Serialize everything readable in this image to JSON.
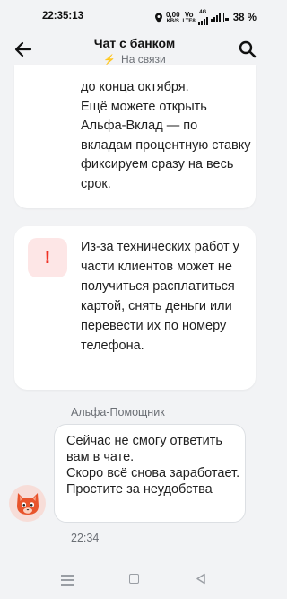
{
  "status_bar": {
    "time": "22:35:13",
    "net_speed_value": "0,00",
    "net_speed_unit": "KB/S",
    "volte_top": "Vo",
    "volte_bottom": "LTE8",
    "network_type": "4G",
    "battery": "38 %"
  },
  "header": {
    "title": "Чат с банком",
    "status": "На связи",
    "back_icon": "arrow-left-icon",
    "search_icon": "search-icon"
  },
  "messages": [
    {
      "text": "до конца октября.\nЕщё можете открыть Альфа-Вклад — по вкладам процентную ставку фиксируем сразу на весь срок."
    },
    {
      "icon": "warning-icon",
      "icon_symbol": "!",
      "text": "Из-за технических работ у части клиентов может не получиться расплатиться картой, снять деньги или перевести их по номеру телефона."
    }
  ],
  "assistant_message": {
    "sender": "Альфа-Помощник",
    "text": "Сейчас не смогу ответить вам в чате.\nСкоро всё снова заработает.\nПростите за неудобства",
    "time": "22:34",
    "avatar_icon": "cat-avatar-icon"
  },
  "colors": {
    "accent_red": "#ef3124",
    "online_green": "#2cb67d",
    "background": "#f2f3f5"
  }
}
